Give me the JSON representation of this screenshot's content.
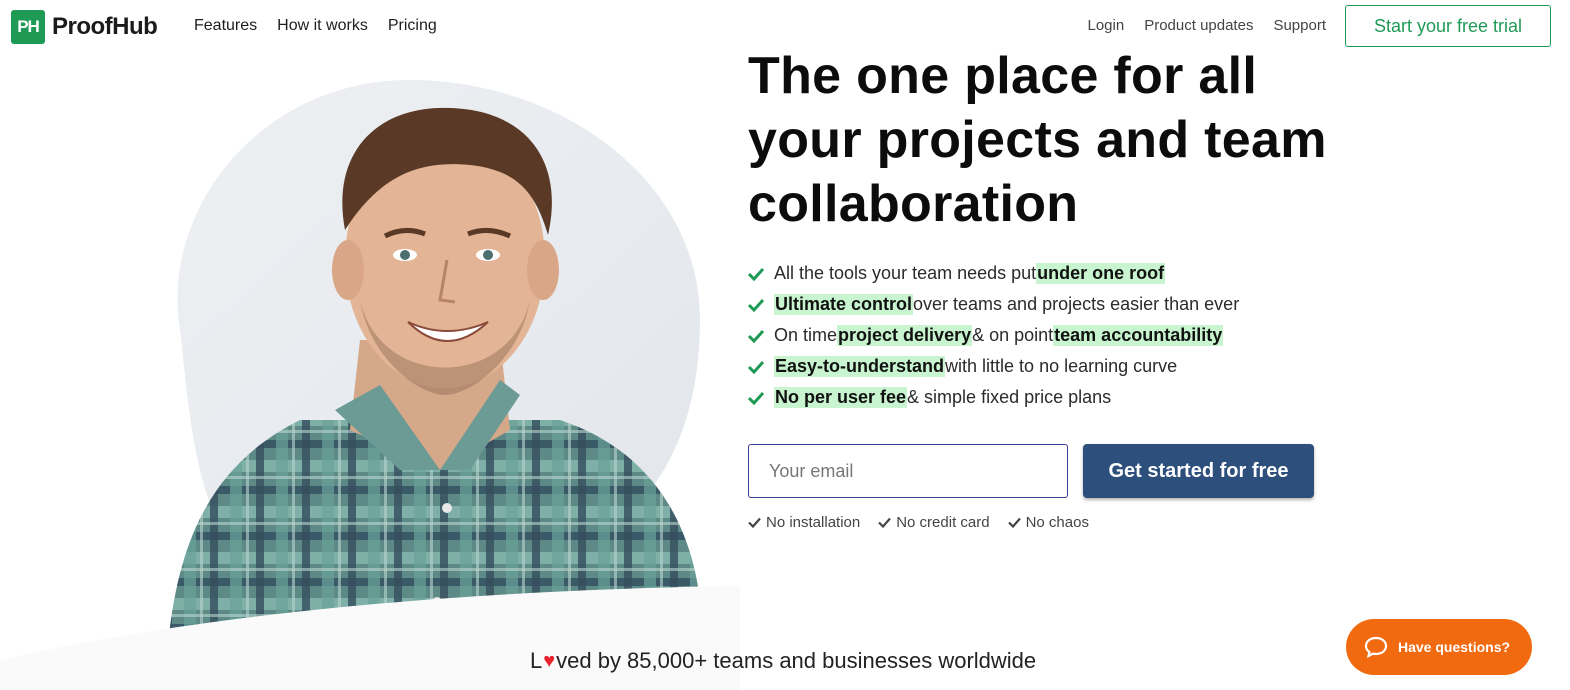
{
  "brand": {
    "badge": "PH",
    "name": "ProofHub",
    "color": "#1f9a55"
  },
  "nav": {
    "left": [
      "Features",
      "How it works",
      "Pricing"
    ],
    "right": [
      "Login",
      "Product updates",
      "Support"
    ],
    "trial_button": "Start your free trial"
  },
  "hero": {
    "headline_lines": [
      "The one place for all",
      "your projects and team",
      "collaboration"
    ],
    "features": [
      {
        "pre": "All the tools your team needs put ",
        "hl": "under one roof",
        "mid": "",
        "hl2": "",
        "post": ""
      },
      {
        "pre": "",
        "hl": "Ultimate control",
        "mid": " over teams and projects easier than ever",
        "hl2": "",
        "post": ""
      },
      {
        "pre": "On time ",
        "hl": "project delivery",
        "mid": " & on point ",
        "hl2": "team accountability",
        "post": ""
      },
      {
        "pre": "",
        "hl": "Easy-to-understand",
        "mid": " with little to no learning curve",
        "hl2": "",
        "post": ""
      },
      {
        "pre": "",
        "hl": "No per user fee",
        "mid": " & simple fixed price plans",
        "hl2": "",
        "post": ""
      }
    ]
  },
  "form": {
    "email_placeholder": "Your email",
    "cta_label": "Get started for free",
    "cta_color": "#2d4f7c",
    "perks": [
      "No installation",
      "No credit card",
      "No chaos"
    ]
  },
  "social_proof": {
    "pre": "L",
    "post": "ved by 85,000+ teams and businesses worldwide"
  },
  "chat": {
    "label": "Have questions?",
    "color": "#f26a10"
  }
}
